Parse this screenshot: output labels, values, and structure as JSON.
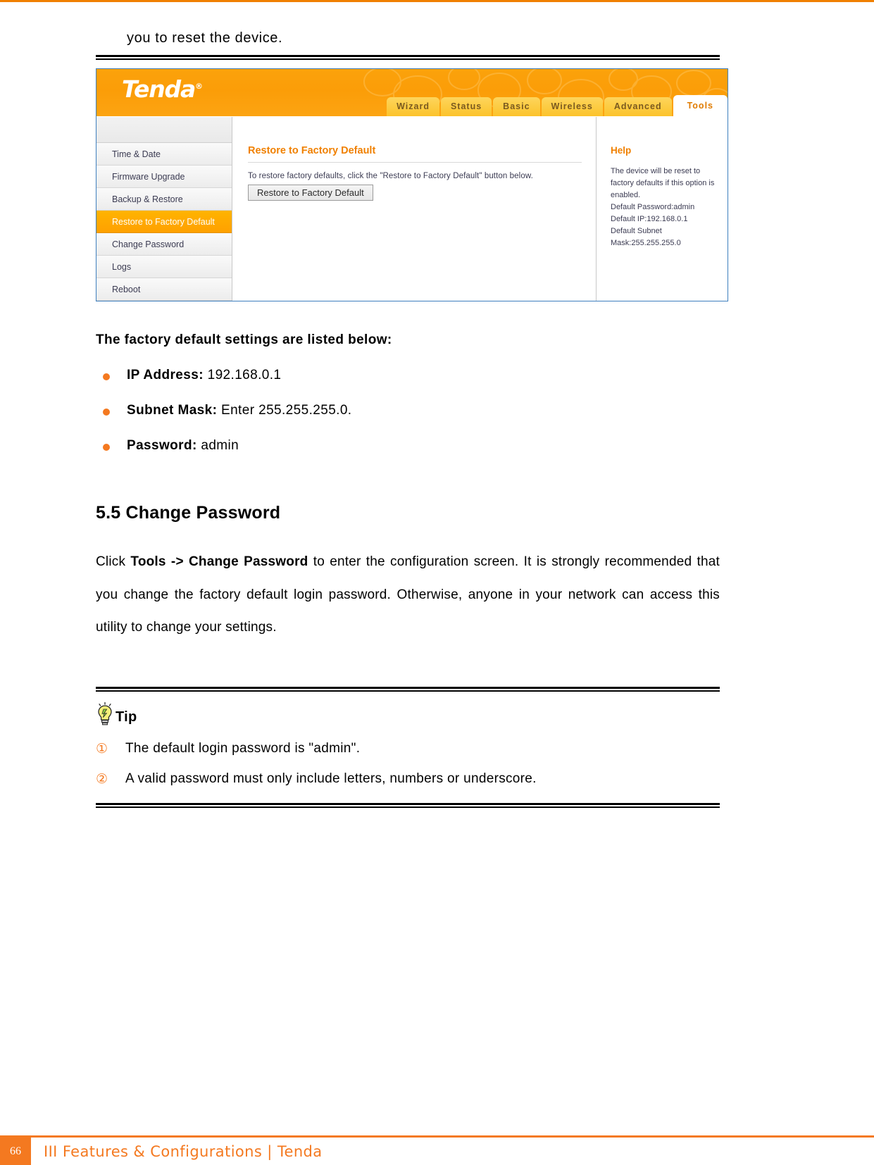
{
  "page": {
    "carryover_text": "you to reset the device.",
    "number": "66",
    "footer_text": "III Features & Configurations | Tenda"
  },
  "router_ui": {
    "brand": "Tenda",
    "brand_mark": "®",
    "tabs": [
      {
        "label": "Wizard",
        "active": false
      },
      {
        "label": "Status",
        "active": false
      },
      {
        "label": "Basic",
        "active": false
      },
      {
        "label": "Wireless",
        "active": false
      },
      {
        "label": "Advanced",
        "active": false
      },
      {
        "label": "Tools",
        "active": true
      }
    ],
    "sidebar": [
      {
        "label": "Time & Date",
        "active": false
      },
      {
        "label": "Firmware Upgrade",
        "active": false
      },
      {
        "label": "Backup & Restore",
        "active": false
      },
      {
        "label": "Restore to Factory Default",
        "active": true
      },
      {
        "label": "Change Password",
        "active": false
      },
      {
        "label": "Logs",
        "active": false
      },
      {
        "label": "Reboot",
        "active": false
      }
    ],
    "main": {
      "title": "Restore to Factory Default",
      "instruction": "To restore factory defaults, click the \"Restore to Factory Default\" button below.",
      "button_label": "Restore to Factory Default"
    },
    "help": {
      "title": "Help",
      "paragraph": "The device will be reset to factory defaults if this option is enabled.",
      "line_password": "Default Password:admin",
      "line_ip": "Default IP:192.168.0.1",
      "line_subnet_1": "Default Subnet",
      "line_subnet_2": "Mask:255.255.255.0"
    },
    "accent_color": "#F08000",
    "header_color": "#FB9D08",
    "active_menu_color": "#FFA800"
  },
  "defaults_section": {
    "heading": "The factory default settings are listed below:",
    "items": [
      {
        "label": "IP Address:",
        "value": "192.168.0.1"
      },
      {
        "label": "Subnet Mask:",
        "value": "Enter 255.255.255.0."
      },
      {
        "label": "Password:",
        "value": "admin"
      }
    ]
  },
  "change_password_section": {
    "heading": "5.5 Change Password",
    "paragraph_before": "Click ",
    "paragraph_bold": "Tools -> Change Password",
    "paragraph_after": " to enter the configuration screen. It is strongly recommended that you change the factory default login password. Otherwise, anyone in your network can access this utility to change your settings."
  },
  "tip": {
    "label": "Tip",
    "items": [
      {
        "num": "①",
        "text": "The default login password is \"admin\"."
      },
      {
        "num": "②",
        "text": "A valid password must only include letters, numbers or underscore."
      }
    ]
  }
}
